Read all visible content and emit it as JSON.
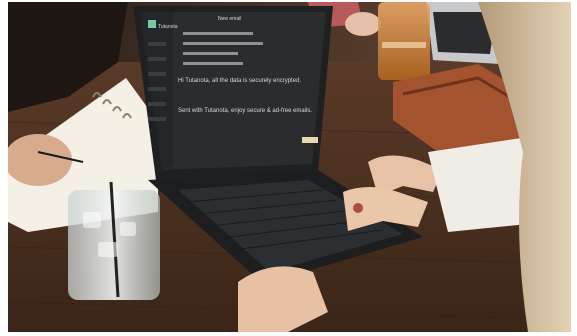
{
  "screen": {
    "app_title": "New email",
    "brand": "Tutanota",
    "compose_line": "Hi Tutanota, all the data is securely encrypted.",
    "signature_line": "Sent with Tutanota, enjoy secure & ad-free emails."
  },
  "colors": {
    "table": "#4a3122",
    "laptop_body": "#1e2022",
    "screen_bg": "#2a2c2e",
    "sidebar_bg": "#24272a",
    "accent": "#7fc6a4"
  }
}
